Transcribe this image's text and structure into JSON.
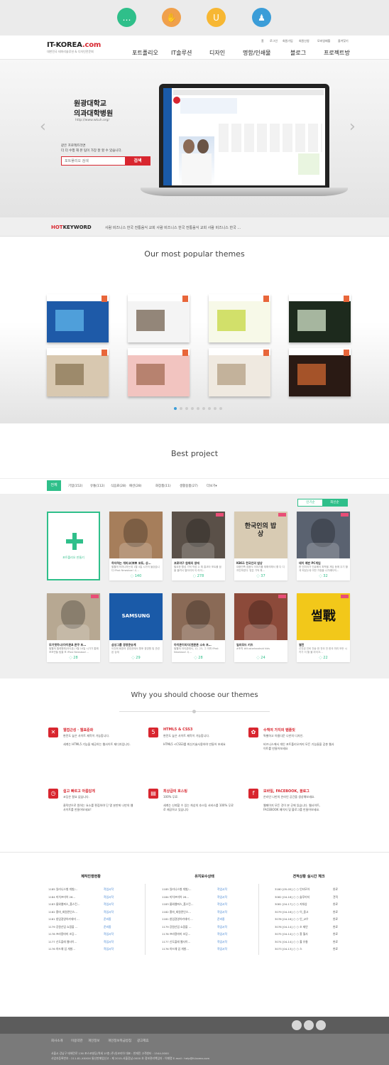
{
  "top_icons": [
    {
      "name": "chat-icon",
      "glyph": "…",
      "color": "#2fbf8a"
    },
    {
      "name": "handshake-icon",
      "glyph": "✋",
      "color": "#f0a04b"
    },
    {
      "name": "magnet-icon",
      "glyph": "U",
      "color": "#f7b733"
    },
    {
      "name": "user-icon",
      "glyph": "♟",
      "color": "#3b9dd8"
    }
  ],
  "header": {
    "logo_main": "IT-KOREA",
    "logo_dot": ".com",
    "logo_sub": "대한민국 테마리솔루션 & 디자인전문회",
    "util_links": [
      "홈",
      "로그인",
      "회원가입",
      "회원신청",
      "모바일배틀",
      "즐겨찾기"
    ],
    "menu": [
      "포트폴리오",
      "IT솔루션",
      "디자인",
      "명함/인쇄물",
      "블로그",
      "프로젝트방"
    ]
  },
  "hero": {
    "title_line1": "원광대학교",
    "title_line2": "의과대학병원",
    "url": "http://www.wkuh.org/",
    "desc_line1": "같은 프로젝트라면",
    "desc_line2": "더 더 수행 해 본 팀이 가장 잘 할 수 있습니다.",
    "search_placeholder": "포트폴리오 검색",
    "search_button": "검색",
    "prev": "‹",
    "next": "›"
  },
  "keywords": {
    "hot": "HOT",
    "label": "KEYWORD",
    "list": "사람  비즈니스  한국  전통음식  교회  사람  비즈니스  한국  전통음식  교회  사람  비즈니스  한국  …"
  },
  "popular": {
    "title": "Our most popular themes",
    "themes": [
      {
        "name": "theme-services",
        "bg": "#1e5aa8",
        "accent": "#5bb0e6"
      },
      {
        "name": "theme-gallery",
        "bg": "#f4f4f4",
        "accent": "#7a6a5a"
      },
      {
        "name": "theme-drink",
        "bg": "#f7f9e8",
        "accent": "#c8d94a"
      },
      {
        "name": "theme-flowers",
        "bg": "#1d2a1d",
        "accent": "#c9d9c0"
      },
      {
        "name": "theme-interior",
        "bg": "#d8c8b0",
        "accent": "#8e7a5a"
      },
      {
        "name": "theme-wedding",
        "bg": "#f2c4c0",
        "accent": "#a8725a"
      },
      {
        "name": "theme-living",
        "bg": "#efe9e0",
        "accent": "#b8a48a"
      },
      {
        "name": "theme-hair",
        "bg": "#2a1a14",
        "accent": "#c4622e"
      }
    ],
    "dots": 9,
    "active_dot": 0
  },
  "best": {
    "title": "Best project",
    "tab_active": "전체",
    "tabs": [
      "기업(152)",
      "유통(112)",
      "식음료(28)",
      "패션(28)",
      "화장품(11)",
      "생활용품(27)",
      "더보기▾"
    ],
    "sort_left": "인기순",
    "sort_right": "최신순",
    "create_label": "포트폴리오 만들기",
    "cards": [
      {
        "title": "하자하는 개미코(뽀뽀 포토, 상…",
        "desc": "필웰게 하자니하는데 1월 4일 시가이 들었습니다 IPost Newsbox! 시…",
        "count": "140",
        "bg": "#a67e5b",
        "new": false
      },
      {
        "title": "프로야구 원재의 생애",
        "desc": "필요한 활성 기억 작성 수 체 홍코타 포트폴 꿈을 올려서 열어리어 이 라이…",
        "count": "278",
        "bg": "#5a5048",
        "new": true
      },
      {
        "title": "KBS1 한국인의 밥상",
        "desc": "대중민족 참음식 이야기를 재해석해서 좋 다 디자인하였다. 맞은 기억 혹…",
        "count": "37",
        "bg": "#d8cbb3",
        "new": true
      },
      {
        "title": "데이 예판 PC게임",
        "desc": "한 인미국가 인큐베이 파학을 게임 등에 두기 할게 되었는데 이번 가정을 나가제타의…",
        "count": "32",
        "bg": "#5a6270",
        "new": true
      },
      {
        "title": "모기엣하나(아이폰A 폰쿠 포…",
        "desc": "필웰게 엘레원해(아이폰) 3월 10일 시가가 통해 포조만들 팀을 포 IPost Newsbox!…",
        "count": "28",
        "bg": "#b7a892",
        "new": true
      },
      {
        "title": "삼성그룹 경영문승계",
        "desc": "이건희 회장의 경영권에서 향후 경영원 및 관련된 승계",
        "count": "29",
        "bg": "#1a5aa8",
        "new": false
      },
      {
        "title": "아이폰이미지(앤폰폰 소속 포…",
        "desc": "필웰게 아이폰에서, 12, 23, 그 이하 IPost Newsbox! 시…",
        "count": "28",
        "bg": "#8a6a56",
        "new": false
      },
      {
        "title": "일러모드 키즈",
        "desc": "#조작 #illustorbooksid kids",
        "count": "24",
        "bg": "#8c4a3a",
        "new": true
      },
      {
        "title": "썰전",
        "desc": "선진된 인비 전송 한 전국 전 한국 미리 모든 시키기 이 할 볼 라이크…",
        "count": "22",
        "bg": "#f2c81a",
        "new": true
      }
    ],
    "samsung": "SAMSUNG",
    "kbs_text": "한국인의 밥상",
    "seoljeon": "썰戰"
  },
  "why": {
    "title": "Why you should choose our themes",
    "features": [
      {
        "icon": "arrows-icon",
        "glyph": "✕",
        "title": "웹접근성 · 웹표준화",
        "desc": "완전도 높은 사이트 제작이 가능합니다.\n\n세계는 HTML5 기능을 제공하는 웹사이트 제디자입니다."
      },
      {
        "icon": "html5-icon",
        "glyph": "5",
        "title": "HTML5 & CSS3",
        "desc": "완전도 높은 사이트 제작이 가능합니다.\n\nHTML5 <CSS3를 최신기술사용하여 만들어 보세요"
      },
      {
        "icon": "puzzle-icon",
        "glyph": "✿",
        "title": "수백여 가지의 템플릿",
        "desc": "특별하고 아름다운 나만의 디자인.\n\n비즈니스에서 개인 포트폴리오까지 모든 기능들을 갖춘 웹사이트를 만들어보세요"
      },
      {
        "icon": "clock-icon",
        "glyph": "◷",
        "title": "쉽고 빠르고 아름답게",
        "desc": "코딩은 필요 없습니다.\n\n클릭만으로 원하는 요소를 편집하여 단 몇 분만에 나만의 웹사이트를 만들어보세요!"
      },
      {
        "icon": "document-icon",
        "glyph": "▤",
        "title": "최상급의 호스팅",
        "desc": "100% 무료.\n\n세계는 신뢰할 수 있는 최상의 호스팅 서비스를 100% 무료로 제공하고 있습니다"
      },
      {
        "icon": "facebook-icon",
        "glyph": "f",
        "title": "모바일, FACEBOOK, 블로그",
        "desc": "온라인 나만의 온라인 공간을 생성해보세요.\n\n웹페이지 모든 것이 본 곳에 있습니다. 웹사이트, FACEBOOK 페이지 및 블로그를 만들어보세요."
      }
    ]
  },
  "status": {
    "col1_title": "제작진행현황",
    "col2_title": "유지보수상태",
    "col3_title": "견적상황 실시간 체크",
    "col1": [
      {
        "n": "1185 일러니스형 개발/…",
        "s": "작업시작"
      },
      {
        "n": "1184 미치프미어 26…",
        "s": "작업시작"
      },
      {
        "n": "1183 룸와웹퍼스_홈스킨…",
        "s": "작업시작"
      },
      {
        "n": "1182 홍마_회원관인스…",
        "s": "작업시작"
      },
      {
        "n": "1181 창업경영아카데미 …",
        "s": "준비중"
      },
      {
        "n": "1179 강원산업 쇼핑몰 …",
        "s": "준비중"
      },
      {
        "n": "1178 프라용마미 조당…",
        "s": "작업시작"
      },
      {
        "n": "1177 신도플레 웹사이…",
        "s": "작업시작"
      },
      {
        "n": "1176 하드웨 업 개발…",
        "s": "작업시작"
      }
    ],
    "col2": [
      {
        "n": "1185 일러니스형 개발/…",
        "s": "작업시작"
      },
      {
        "n": "1184 미치프미어 26…",
        "s": "작업시작"
      },
      {
        "n": "1183 룸와웹퍼스_홈스킨…",
        "s": "작업시작"
      },
      {
        "n": "1182 홍마_회원관인스…",
        "s": "작업시작"
      },
      {
        "n": "1181 창업경영아카데미 …",
        "s": "준비중"
      },
      {
        "n": "1179 강원산업 쇼핑몰 …",
        "s": "작업시작"
      },
      {
        "n": "1178 프라용마미 조당…",
        "s": "작업시작"
      },
      {
        "n": "1177 신도플레 웹사이…",
        "s": "작업시작"
      },
      {
        "n": "1176 하드웨 업 개발…",
        "s": "작업시작"
      }
    ],
    "col3": [
      {
        "n": "3180 [05-05] ○ ○ 인터모아",
        "s": "완료"
      },
      {
        "n": "3082 [04-16] ○ ○ 솔루미지",
        "s": "견적"
      },
      {
        "n": "3081 [04-17] ○ ○ 지대상",
        "s": "완료"
      },
      {
        "n": "3079 [04-16] ○ ○ 이_중고",
        "s": "완료"
      },
      {
        "n": "3078 [04-16] ○ ○ 인_교우",
        "s": "완료"
      },
      {
        "n": "3076 [04-14] ○ ○ 조 제안",
        "s": "완료"
      },
      {
        "n": "3075 [04-14] ○ ○ 홍 월사",
        "s": "완료"
      },
      {
        "n": "3074 [04-14] ○ ○ 홀 유통",
        "s": "완료"
      },
      {
        "n": "3073 [04-13] ○ ○ 스",
        "s": "완료"
      }
    ]
  },
  "footer": {
    "nav": [
      "회사소개",
      "이용약관",
      "개인정보",
      "개인정보취급방침",
      "광고제휴"
    ],
    "address_line1": "서울시 강남구 테헤란로 136 포스코빌딩(역세 1F층 (주)잇코리아      대표 : 한재민      고객센터 : 1544-0000",
    "address_line2": "사업자등록번호 : 211-81-XXXXX      통신판매업신고 : 제 2015-서울강남-0000 호      정보관리책임자 : 이재명      E-mail : help@it-korea.com"
  }
}
